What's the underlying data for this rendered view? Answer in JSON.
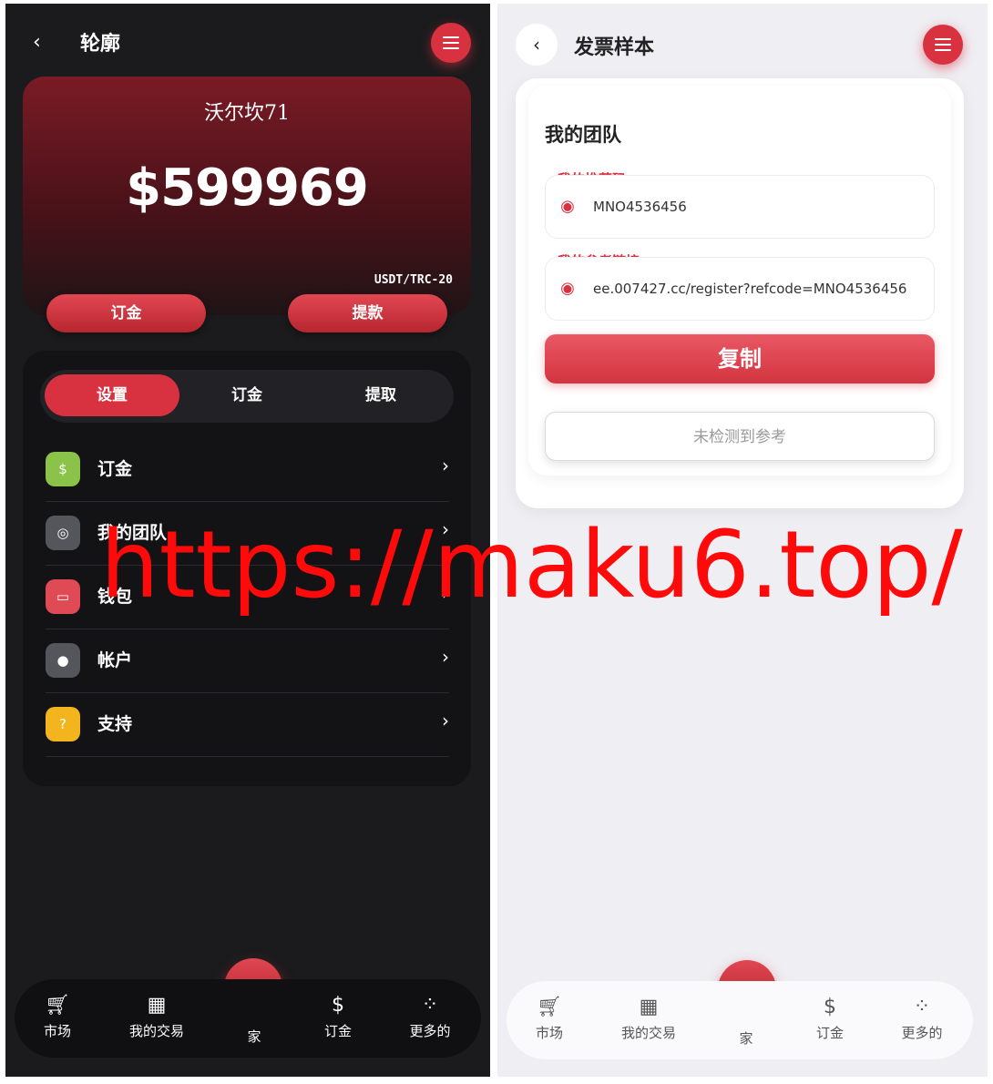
{
  "left": {
    "header": {
      "back_icon": "chevron-left-icon",
      "title": "轮廓",
      "menu_icon": "hamburger-menu-icon"
    },
    "balance": {
      "name": "沃尔坎71",
      "amount": "$599969",
      "unit": "USDT/TRC-20",
      "deposit_label": "订金",
      "withdraw_label": "提款"
    },
    "tabs": [
      {
        "label": "设置",
        "active": true
      },
      {
        "label": "订金",
        "active": false
      },
      {
        "label": "提取",
        "active": false
      }
    ],
    "menu": [
      {
        "label": "订金",
        "icon": "money-icon",
        "color": "#8bc34a"
      },
      {
        "label": "我的团队",
        "icon": "team-icon",
        "color": "#55565c"
      },
      {
        "label": "钱包",
        "icon": "wallet-icon",
        "color": "#e04a55"
      },
      {
        "label": "帐户",
        "icon": "user-icon",
        "color": "#55565c"
      },
      {
        "label": "支持",
        "icon": "help-icon",
        "color": "#f2b51d"
      }
    ],
    "nav": [
      {
        "label": "市场",
        "icon": "cart-icon"
      },
      {
        "label": "我的交易",
        "icon": "grid-icon"
      },
      {
        "label": "家",
        "icon": "home-icon"
      },
      {
        "label": "订金",
        "icon": "money-icon"
      },
      {
        "label": "更多的",
        "icon": "more-icon"
      }
    ]
  },
  "right": {
    "header": {
      "back_icon": "chevron-left-icon",
      "title": "发票样本",
      "menu_icon": "hamburger-menu-icon"
    },
    "card": {
      "title": "我的团队",
      "referral_code_label": "我的推荐码",
      "referral_code": "MNO4536456",
      "referral_link_label": "我的参考链接",
      "referral_link": "ee.007427.cc/register?refcode=MNO4536456",
      "copy_label": "复制",
      "no_ref_label": "未检测到参考"
    },
    "nav": [
      {
        "label": "市场",
        "icon": "cart-icon"
      },
      {
        "label": "我的交易",
        "icon": "grid-icon"
      },
      {
        "label": "家",
        "icon": "home-icon"
      },
      {
        "label": "订金",
        "icon": "money-icon"
      },
      {
        "label": "更多的",
        "icon": "more-icon"
      }
    ]
  },
  "watermark": "https://maku6.top/"
}
